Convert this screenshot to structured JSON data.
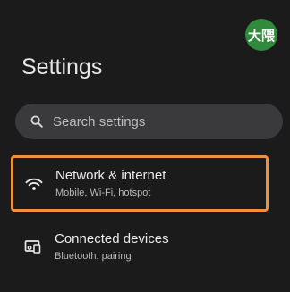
{
  "header": {
    "avatar_text": "大隈",
    "avatar_color": "#2f8a3c",
    "title": "Settings"
  },
  "search": {
    "icon": "search-icon",
    "placeholder": "Search settings"
  },
  "items": [
    {
      "icon": "wifi-icon",
      "title": "Network & internet",
      "subtitle": "Mobile, Wi-Fi, hotspot",
      "highlight_color": "#f0913a"
    },
    {
      "icon": "connected-devices-icon",
      "title": "Connected devices",
      "subtitle": "Bluetooth, pairing"
    }
  ]
}
